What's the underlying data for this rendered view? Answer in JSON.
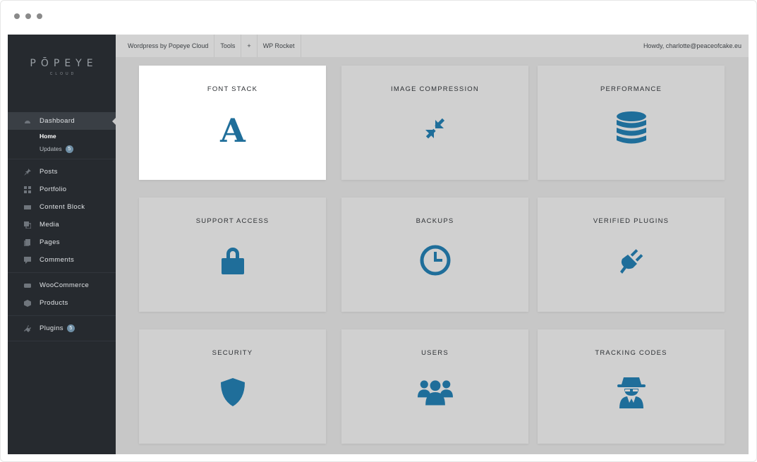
{
  "sidebar": {
    "logo_main": "PŌPEYE",
    "logo_sub": "CLOUD",
    "items": [
      {
        "label": "Dashboard",
        "icon": "dashboard-icon"
      },
      {
        "label": "Posts",
        "icon": "pin-icon"
      },
      {
        "label": "Portfolio",
        "icon": "grid-icon"
      },
      {
        "label": "Content Block",
        "icon": "block-icon"
      },
      {
        "label": "Media",
        "icon": "media-icon"
      },
      {
        "label": "Pages",
        "icon": "pages-icon"
      },
      {
        "label": "Comments",
        "icon": "comment-icon"
      },
      {
        "label": "WooCommerce",
        "icon": "woo-icon"
      },
      {
        "label": "Products",
        "icon": "box-icon"
      },
      {
        "label": "Plugins",
        "icon": "plug-icon",
        "badge": "5"
      }
    ],
    "submenu": [
      {
        "label": "Home"
      },
      {
        "label": "Updates",
        "badge": "5"
      }
    ]
  },
  "topbar": {
    "items": [
      "Wordpress by Popeye Cloud",
      "Tools",
      "+",
      "WP Rocket"
    ],
    "howdy": "Howdy, charlotte@peaceofcake.eu"
  },
  "cards": [
    {
      "title": "FONT STACK",
      "icon": "font-icon"
    },
    {
      "title": "IMAGE COMPRESSION",
      "icon": "compress-icon"
    },
    {
      "title": "PERFORMANCE",
      "icon": "database-icon"
    },
    {
      "title": "SUPPORT ACCESS",
      "icon": "lock-icon"
    },
    {
      "title": "BACKUPS",
      "icon": "clock-icon"
    },
    {
      "title": "VERIFIED PLUGINS",
      "icon": "plug-icon"
    },
    {
      "title": "SECURITY",
      "icon": "shield-icon"
    },
    {
      "title": "USERS",
      "icon": "users-icon"
    },
    {
      "title": "TRACKING CODES",
      "icon": "spy-icon"
    }
  ],
  "colors": {
    "sidebar_bg": "#262a2f",
    "accent": "#1f6e9a",
    "card_bg": "#d0d0d0",
    "content_bg": "#c7c7c7"
  }
}
